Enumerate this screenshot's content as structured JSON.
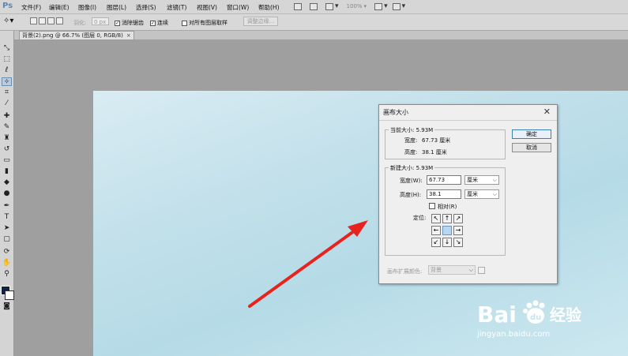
{
  "app": {
    "logo": "Ps",
    "menu": [
      "文件(F)",
      "编辑(E)",
      "图像(I)",
      "图层(L)",
      "选择(S)",
      "滤镜(T)",
      "视图(V)",
      "窗口(W)",
      "帮助(H)"
    ],
    "zoom_display": "100%"
  },
  "options_bar": {
    "feather_label": "羽化:",
    "feather_value": "0 px",
    "anti_alias_label": "消除锯齿",
    "contiguous_label": "连续",
    "sample_all_label": "对所有图层取样",
    "refine_edge_label": "调整边缘..."
  },
  "document_tab": {
    "title": "背景(2).png @ 66.7% (图层 0, RGB/8)",
    "close": "×"
  },
  "dialog": {
    "title": "画布大小",
    "close_icon": "✕",
    "current_size": {
      "legend": "当前大小: 5.93M",
      "width_label": "宽度:",
      "width_value": "67.73 厘米",
      "height_label": "高度:",
      "height_value": "38.1 厘米"
    },
    "new_size": {
      "legend": "新建大小: 5.93M",
      "width_label": "宽度(W):",
      "width_value": "67.73",
      "width_unit": "厘米",
      "height_label": "高度(H):",
      "height_value": "38.1",
      "height_unit": "厘米",
      "relative_label": "相对(R)",
      "anchor_label": "定位:",
      "anchor_selected": "center",
      "anchor_arrows": [
        "↖",
        "↑",
        "↗",
        "←",
        "",
        "→",
        "↙",
        "↓",
        "↘"
      ]
    },
    "ok_label": "确定",
    "cancel_label": "取消",
    "extension_color_label": "画布扩展颜色:",
    "extension_color_value": "背景"
  },
  "watermark": {
    "brand": "Bai du 经验",
    "url": "jingyan.baidu.com"
  },
  "colors": {
    "foreground": "#0f2342",
    "background": "#ffffff",
    "arrow": "#e8231d"
  }
}
